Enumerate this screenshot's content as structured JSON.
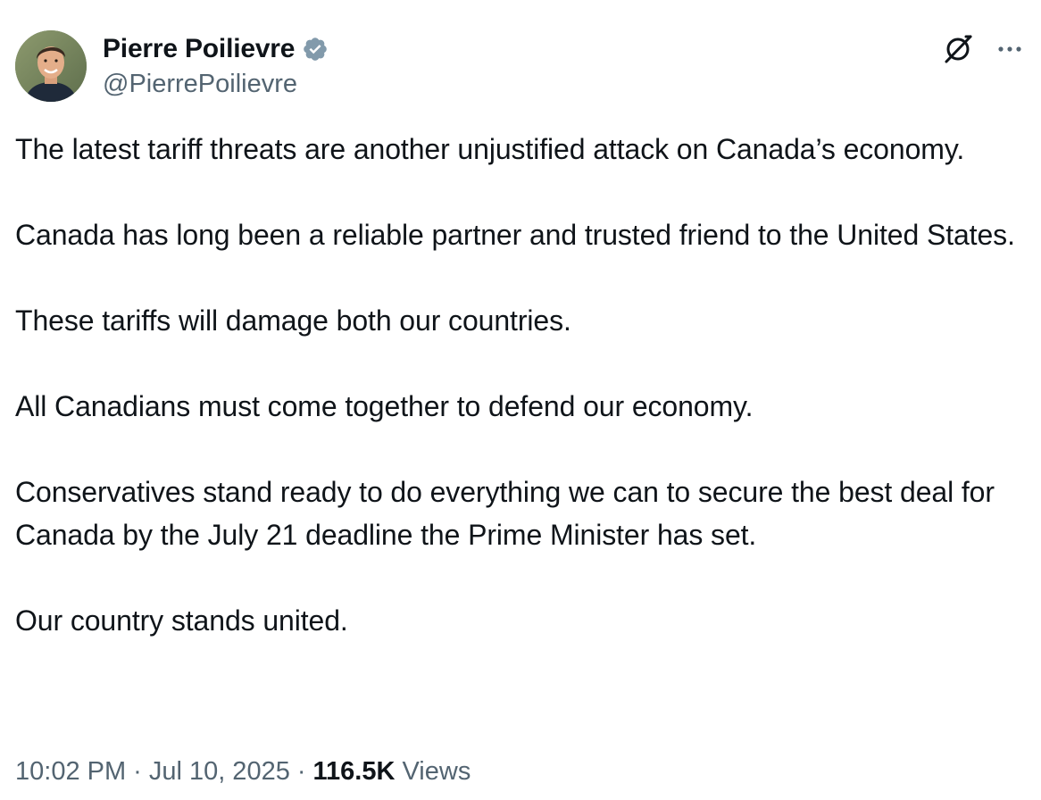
{
  "author": {
    "display_name": "Pierre Poilievre",
    "handle": "@PierrePoilievre",
    "verified": true,
    "verified_color": "#829aab"
  },
  "icons": {
    "grok": "grok-icon",
    "more": "more-options-icon",
    "verified": "verified-badge-icon"
  },
  "body": {
    "paragraphs": [
      "The latest tariff threats are another unjustified attack on Canada’s economy.",
      "Canada has long been a reliable partner and trusted friend to the United States.",
      "These tariffs will damage both our countries.",
      "All Canadians must come together to defend our economy.",
      "Conservatives stand ready to do everything we can to secure the best deal for Canada by the July 21 deadline the Prime Minister has set.",
      "Our country stands united."
    ]
  },
  "meta": {
    "time": "10:02 PM",
    "date": "Jul 10, 2025",
    "separator": "·",
    "views_count": "116.5K",
    "views_label": "Views"
  },
  "colors": {
    "text_primary": "#0f1419",
    "text_secondary": "#536471"
  }
}
